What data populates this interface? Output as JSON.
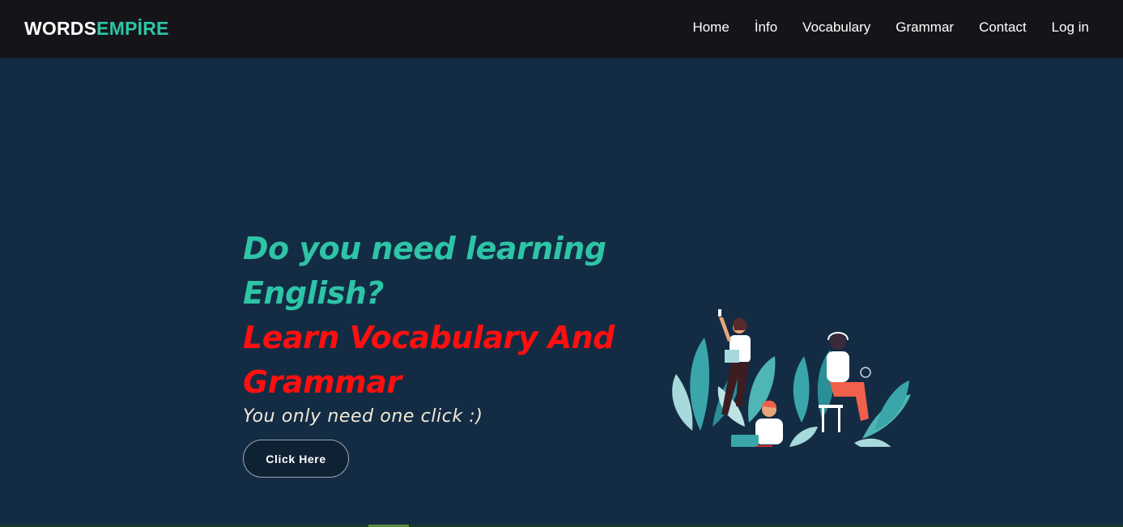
{
  "brand": {
    "part1": "WORDS",
    "part2": "EMPİRE"
  },
  "nav": {
    "items": [
      {
        "label": "Home"
      },
      {
        "label": "İnfo"
      },
      {
        "label": "Vocabulary"
      },
      {
        "label": "Grammar"
      },
      {
        "label": "Contact"
      },
      {
        "label": "Log in"
      }
    ]
  },
  "hero": {
    "headline_line1": "Do you need learning English?",
    "headline_line2": "Learn Vocabulary And Grammar",
    "subtitle": "You only need one click :)",
    "cta_label": "Click Here",
    "illustration_icon": "people-learning-illustration"
  },
  "colors": {
    "navbar": "#151519",
    "hero_bg": "#132c44",
    "accent_teal": "#2ec4a6",
    "accent_red": "#ff0f0f"
  }
}
